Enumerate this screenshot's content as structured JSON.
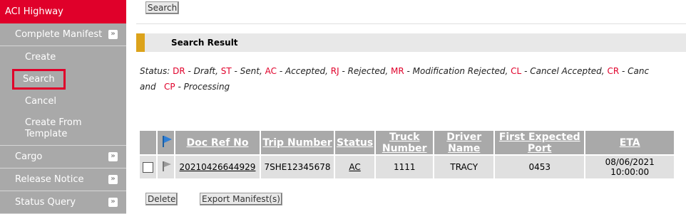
{
  "sidebar": {
    "title": "ACI Highway",
    "complete_manifest": "Complete Manifest",
    "sub_items": [
      "Create",
      "Search",
      "Cancel",
      "Create From Template"
    ],
    "cargo": "Cargo",
    "release_notice": "Release Notice",
    "status_query": "Status Query",
    "chevron_glyph": "»"
  },
  "toolbar": {
    "search_label": "Search"
  },
  "result": {
    "title": "Search Result"
  },
  "status_legend": {
    "prefix": "Status:",
    "items": [
      {
        "code": "DR",
        "desc": " - Draft,"
      },
      {
        "code": "ST",
        "desc": " - Sent,"
      },
      {
        "code": "AC",
        "desc": " - Accepted,"
      },
      {
        "code": "RJ",
        "desc": " - Rejected,"
      },
      {
        "code": "MR",
        "desc": " - Modification Rejected,"
      },
      {
        "code": "CL",
        "desc": " - Cancel Accepted,"
      },
      {
        "code": "CR",
        "desc": " - Canc"
      }
    ],
    "line2_prefix": "and",
    "line2_code": "CP",
    "line2_desc": " - Processing"
  },
  "table": {
    "headers": [
      "Doc Ref No",
      "Trip Number",
      "Status",
      "Truck Number",
      "Driver Name",
      "First Expected Port",
      "ETA"
    ],
    "header_lines": {
      "truck": [
        "Truck",
        "Number"
      ],
      "driver": [
        "Driver",
        "Name"
      ],
      "port": [
        "First Expected",
        "Port"
      ]
    },
    "rows": [
      {
        "doc_ref": "20210426644929",
        "trip": "7SHE12345678",
        "status": "AC",
        "truck": "1111",
        "driver": "TRACY",
        "port": "0453",
        "eta_date": "08/06/2021",
        "eta_time": "10:00:00"
      }
    ]
  },
  "actions": {
    "delete_label": "Delete",
    "export_label": "Export Manifest(s)"
  },
  "colors": {
    "accent_red": "#e0002a",
    "sidebar_grey": "#a9a9a9",
    "accent_gold": "#dca31b",
    "flag_blue": "#2f7fd6"
  }
}
